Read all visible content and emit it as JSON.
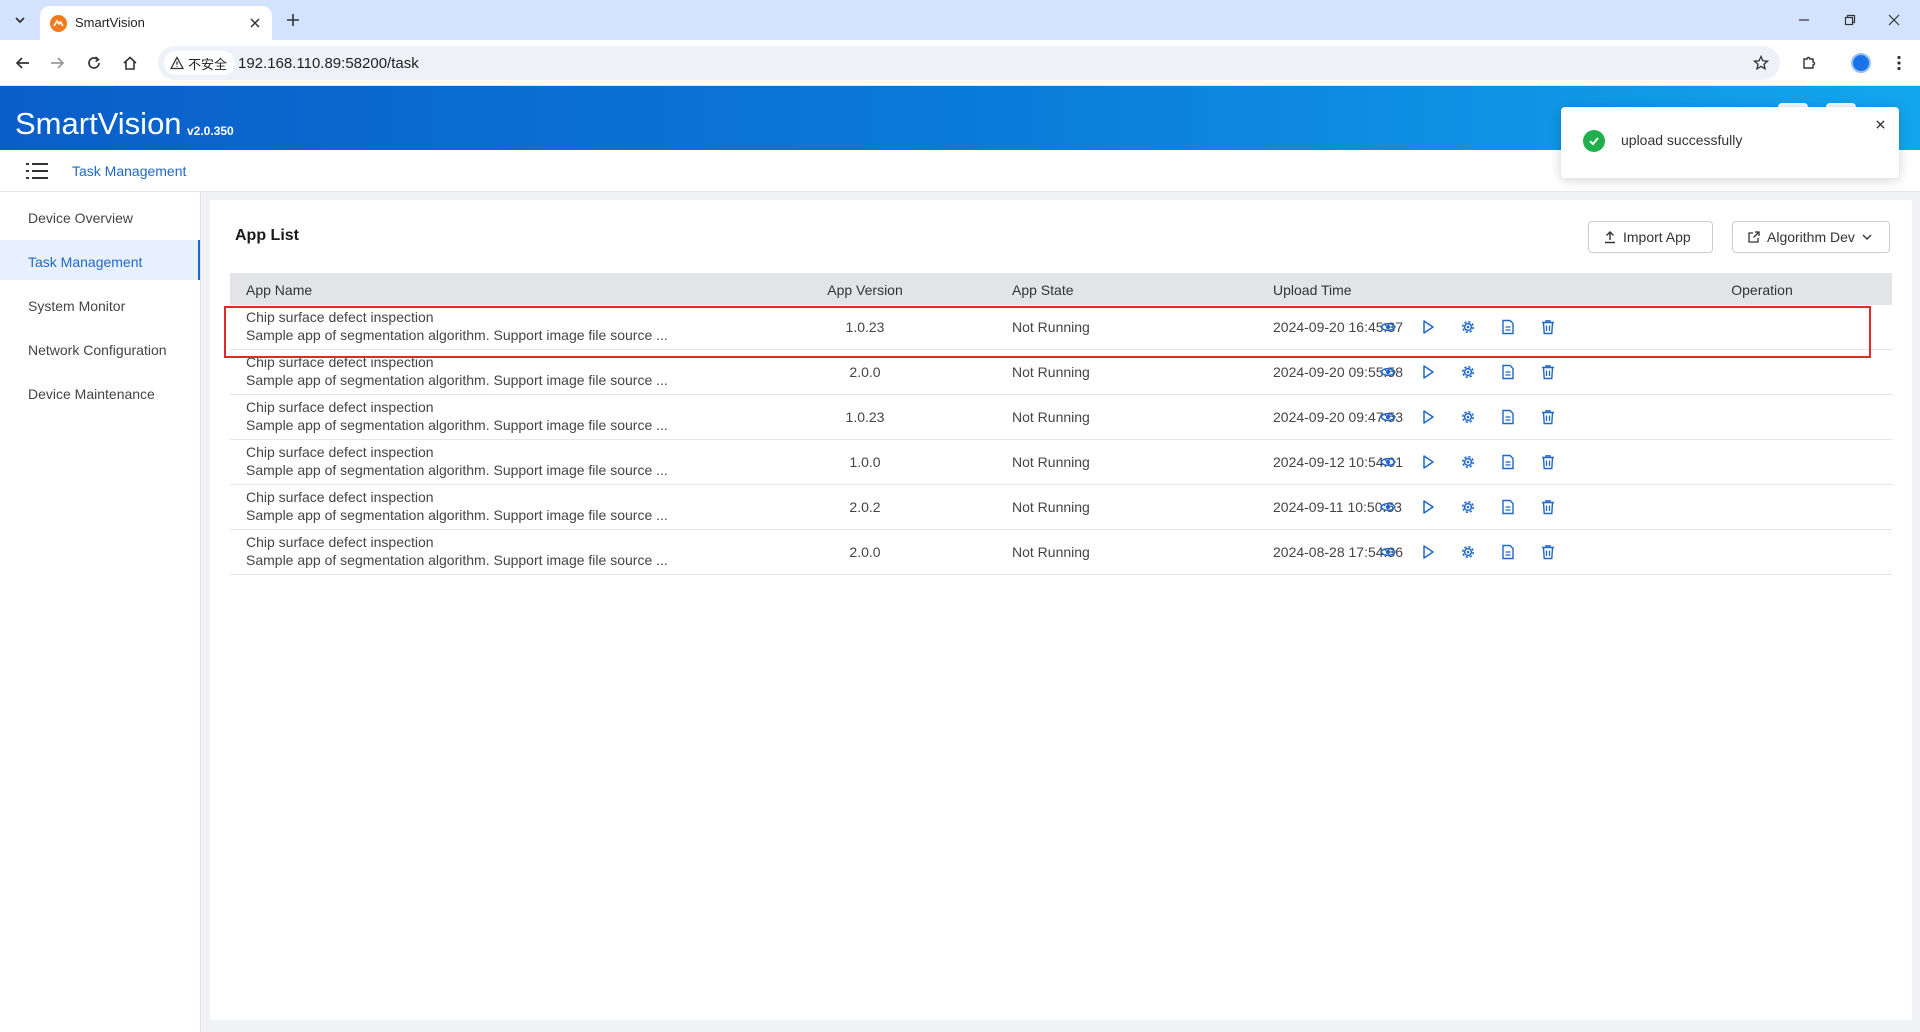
{
  "browser": {
    "tab_title": "SmartVision",
    "security_label": "不安全",
    "url": "192.168.110.89:58200/task"
  },
  "app": {
    "brand": "SmartVision",
    "version": "v2.0.350",
    "accent_color": "#1f68c9"
  },
  "breadcrumb": {
    "current": "Task Management"
  },
  "sidebar": {
    "items": [
      {
        "label": "Device Overview",
        "active": false
      },
      {
        "label": "Task Management",
        "active": true
      },
      {
        "label": "System Monitor",
        "active": false
      },
      {
        "label": "Network Configuration",
        "active": false
      },
      {
        "label": "Device Maintenance",
        "active": false
      }
    ]
  },
  "panel": {
    "title": "App List",
    "import_label": "Import App",
    "algo_label": "Algorithm Dev"
  },
  "table": {
    "columns": [
      "App Name",
      "App Version",
      "App State",
      "Upload Time",
      "Operation"
    ],
    "operations": [
      "view-icon",
      "run-icon",
      "settings-icon",
      "log-icon",
      "delete-icon"
    ],
    "rows": [
      {
        "name": "Chip surface defect inspection",
        "desc": "Sample app of segmentation algorithm. Support image file source ...",
        "version": "1.0.23",
        "state": "Not Running",
        "time": "2024-09-20 16:45:37"
      },
      {
        "name": "Chip surface defect inspection",
        "desc": "Sample app of segmentation algorithm. Support image file source ...",
        "version": "2.0.0",
        "state": "Not Running",
        "time": "2024-09-20 09:55:58"
      },
      {
        "name": "Chip surface defect inspection",
        "desc": "Sample app of segmentation algorithm. Support image file source ...",
        "version": "1.0.23",
        "state": "Not Running",
        "time": "2024-09-20 09:47:53"
      },
      {
        "name": "Chip surface defect inspection",
        "desc": "Sample app of segmentation algorithm. Support image file source ...",
        "version": "1.0.0",
        "state": "Not Running",
        "time": "2024-09-12 10:54:01"
      },
      {
        "name": "Chip surface defect inspection",
        "desc": "Sample app of segmentation algorithm. Support image file source ...",
        "version": "2.0.2",
        "state": "Not Running",
        "time": "2024-09-11 10:50:53"
      },
      {
        "name": "Chip surface defect inspection",
        "desc": "Sample app of segmentation algorithm. Support image file source ...",
        "version": "2.0.0",
        "state": "Not Running",
        "time": "2024-08-28 17:54:36"
      }
    ]
  },
  "toast": {
    "message": "upload successfully",
    "status_color": "#20b04b"
  }
}
